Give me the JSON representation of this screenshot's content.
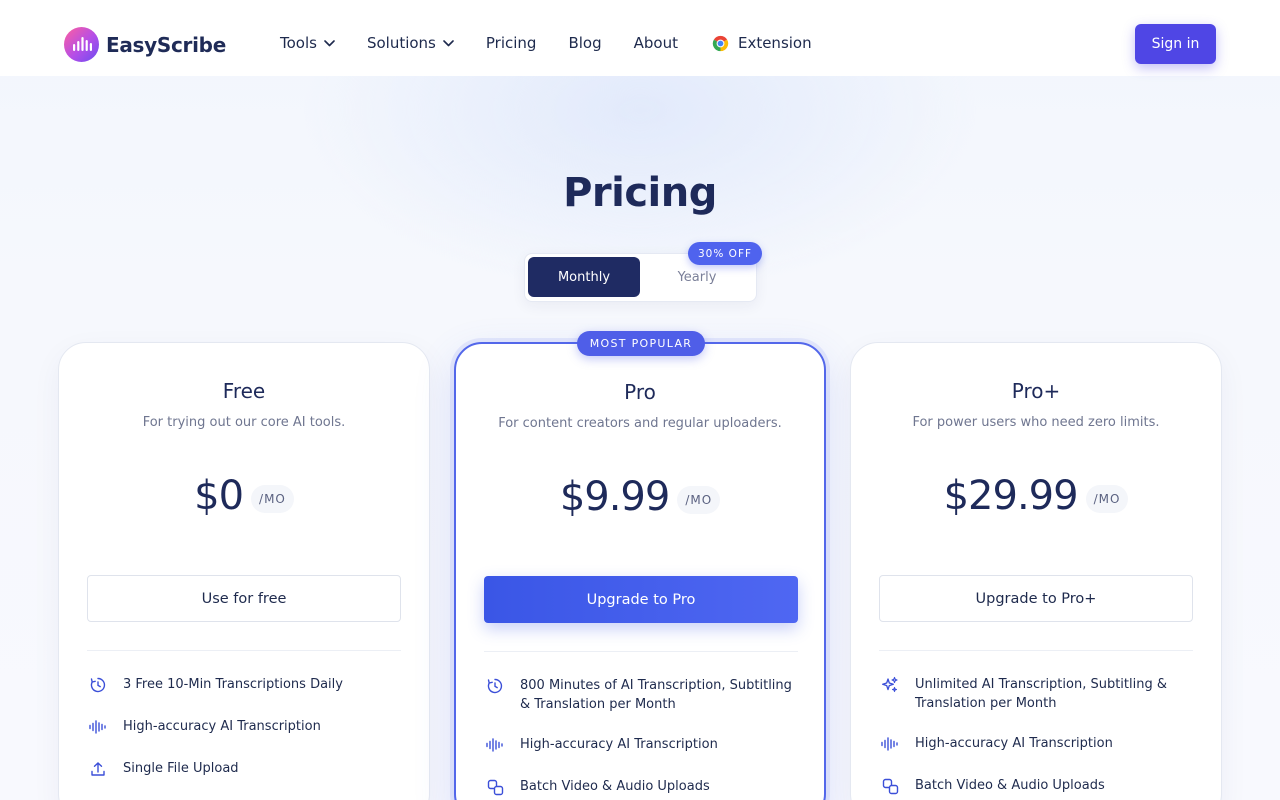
{
  "brand": {
    "name": "EasyScribe"
  },
  "nav": {
    "items": [
      {
        "label": "Tools",
        "has_dropdown": true
      },
      {
        "label": "Solutions",
        "has_dropdown": true
      },
      {
        "label": "Pricing",
        "has_dropdown": false
      },
      {
        "label": "Blog",
        "has_dropdown": false
      },
      {
        "label": "About",
        "has_dropdown": false
      }
    ],
    "extension_label": "Extension",
    "signin_label": "Sign in"
  },
  "page": {
    "title": "Pricing",
    "billing_toggle": {
      "monthly_label": "Monthly",
      "yearly_label": "Yearly",
      "discount_badge": "30% OFF",
      "selected": "Monthly"
    }
  },
  "plans": [
    {
      "name": "Free",
      "description": "For trying out our core AI tools.",
      "price": "$0",
      "period": "/MO",
      "cta": "Use for free",
      "features": [
        {
          "icon": "timer-icon",
          "text": "3 Free 10-Min Transcriptions Daily"
        },
        {
          "icon": "waveform-icon",
          "text": "High-accuracy AI Transcription"
        },
        {
          "icon": "upload-icon",
          "text": "Single File Upload"
        }
      ]
    },
    {
      "name": "Pro",
      "badge": "MOST POPULAR",
      "description": "For content creators and regular uploaders.",
      "price": "$9.99",
      "period": "/MO",
      "cta": "Upgrade to Pro",
      "features": [
        {
          "icon": "timer-icon",
          "text": "800 Minutes of AI Transcription, Subtitling & Translation per Month"
        },
        {
          "icon": "waveform-icon",
          "text": "High-accuracy AI Transcription"
        },
        {
          "icon": "batch-upload-icon",
          "text": "Batch Video & Audio Uploads"
        }
      ]
    },
    {
      "name": "Pro+",
      "description": "For power users who need zero limits.",
      "price": "$29.99",
      "period": "/MO",
      "cta": "Upgrade to Pro+",
      "features": [
        {
          "icon": "sparkles-icon",
          "text": "Unlimited AI Transcription, Subtitling & Translation per Month"
        },
        {
          "icon": "waveform-icon",
          "text": "High-accuracy AI Transcription"
        },
        {
          "icon": "batch-upload-icon",
          "text": "Batch Video & Audio Uploads"
        }
      ]
    }
  ],
  "colors": {
    "accent": "#4f46e5",
    "primary_button": "#3a56e6",
    "toggle_active": "#1f2b63",
    "heading": "#1e2a5a"
  }
}
